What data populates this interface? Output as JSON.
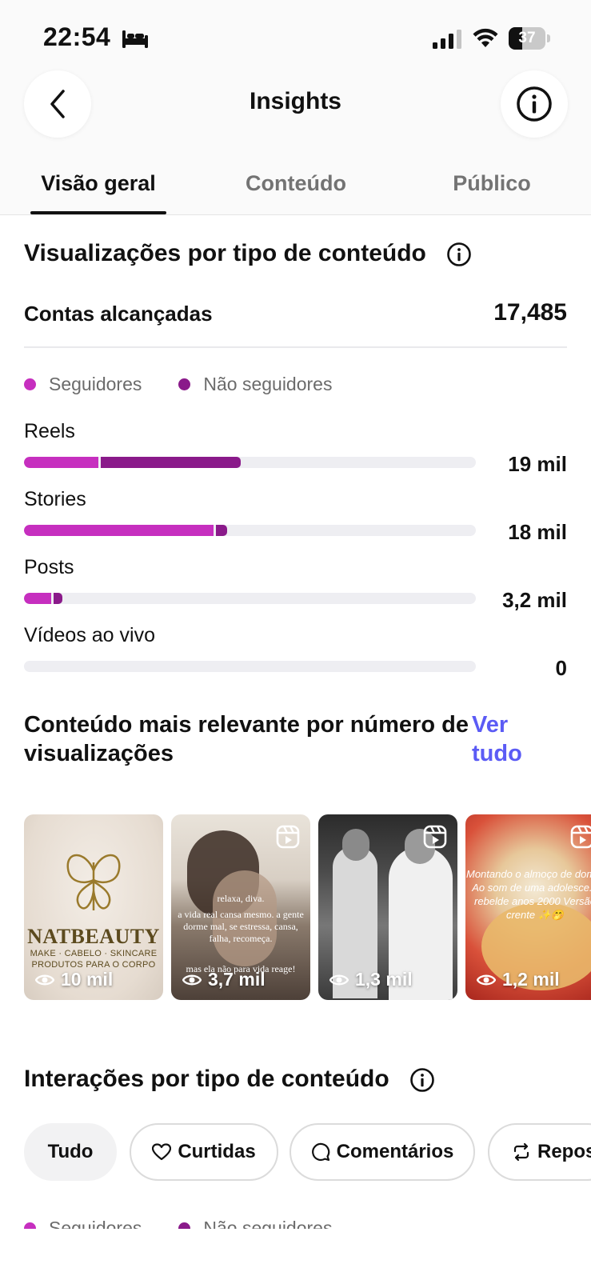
{
  "status_bar": {
    "time": "22:54",
    "battery": "37",
    "battery_level": 0.37
  },
  "header": {
    "title": "Insights"
  },
  "tabs": [
    {
      "label": "Visão geral",
      "active": true
    },
    {
      "label": "Conteúdo",
      "active": false
    },
    {
      "label": "Público",
      "active": false
    }
  ],
  "views_section": {
    "title": "Visualizações por tipo de conteúdo",
    "reach_label": "Contas alcançadas",
    "reach_value": "17,485",
    "legend": {
      "followers": "Seguidores",
      "non_followers": "Não seguidores"
    },
    "metrics": [
      {
        "label": "Reels",
        "value": "19 mil",
        "followers_fraction": 0.165,
        "non_followers_fraction": 0.31
      },
      {
        "label": "Stories",
        "value": "18 mil",
        "followers_fraction": 0.42,
        "non_followers_fraction": 0.025
      },
      {
        "label": "Posts",
        "value": "3,2 mil",
        "followers_fraction": 0.06,
        "non_followers_fraction": 0.02
      },
      {
        "label": "Vídeos ao vivo",
        "value": "0",
        "followers_fraction": 0,
        "non_followers_fraction": 0
      }
    ]
  },
  "top_content": {
    "title": "Conteúdo mais relevante por número de visualizações",
    "see_all": "Ver tudo",
    "items": [
      {
        "views": "10 mil",
        "type": "post",
        "logo": "NATBEAUTY",
        "logo_sub_1": "MAKE · CABELO · SKINCARE",
        "logo_sub_2": "PRODUTOS PARA O CORPO"
      },
      {
        "views": "3,7 mil",
        "type": "reel",
        "overlay_1": "relaxa, diva.",
        "overlay_2": "a vida real cansa mesmo. a gente dorme mal, se estressa, cansa, falha, recomeça.",
        "overlay_3": "mas ela não para vida reage!"
      },
      {
        "views": "1,3 mil",
        "type": "reel"
      },
      {
        "views": "1,2 mil",
        "type": "reel",
        "caption": "Montando o almoço de dom... Ao som de uma adolesce... rebelde anos 2000 Versão crente ✨🤭"
      }
    ]
  },
  "interactions_section": {
    "title": "Interações por tipo de conteúdo",
    "chips": [
      {
        "label": "Tudo",
        "icon": "none",
        "active": true
      },
      {
        "label": "Curtidas",
        "icon": "heart-icon",
        "active": false
      },
      {
        "label": "Comentários",
        "icon": "comment-icon",
        "active": false
      },
      {
        "label": "Repos",
        "icon": "repost-icon",
        "active": false
      }
    ],
    "legend": {
      "followers": "Seguidores",
      "non_followers": "Não seguidores"
    }
  },
  "colors": {
    "followers": "#c62fbf",
    "non_followers": "#8a1a8a",
    "link": "#5b5bf5",
    "track": "#eeeef2"
  }
}
